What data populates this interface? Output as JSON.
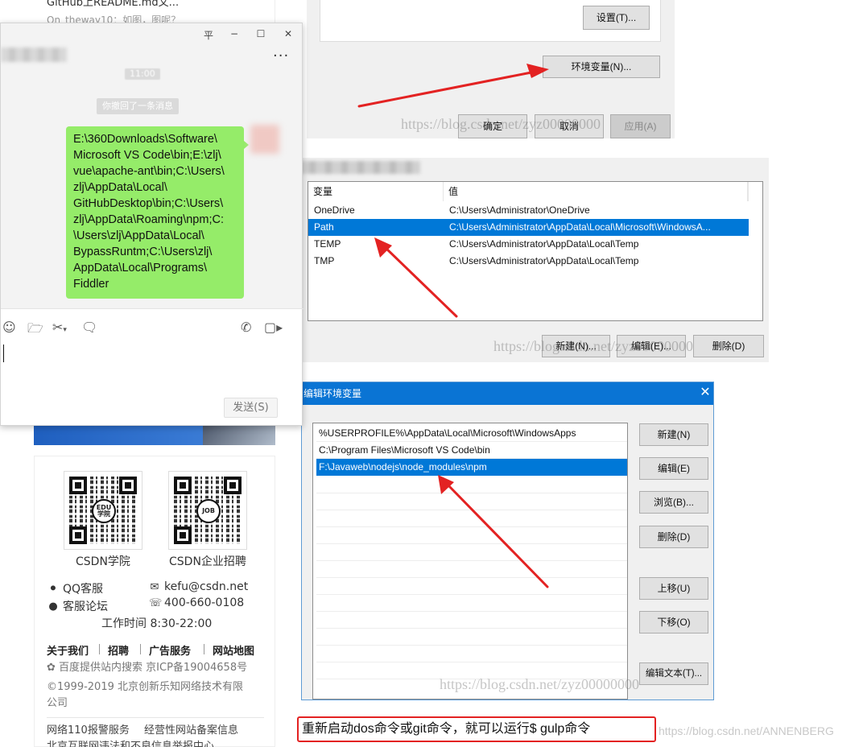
{
  "csdn": {
    "top_text": "GitHub上README.md文...",
    "top_meta": "On_theway10：如图，图呢？",
    "qr": [
      {
        "caption": "CSDN学院",
        "logo": "EDU 学院"
      },
      {
        "caption": "CSDN企业招聘",
        "logo": "JOB"
      }
    ],
    "contact": {
      "qq": "QQ客服",
      "email": "kefu@csdn.net",
      "forum": "客服论坛",
      "phone": "400-660-0108",
      "hours": "工作时间 8:30-22:00"
    },
    "footer_links": [
      "关于我们",
      "招聘",
      "广告服务",
      "网站地图"
    ],
    "footer_lines": [
      "百度提供站内搜索 京ICP备19004658号",
      "©1999-2019 北京创新乐知网络技术有限",
      "公司"
    ],
    "footer_bottom": [
      "网络110报警服务",
      "经营性网站备案信息"
    ],
    "footer_cut": "北京互联网违法和不良信息举报中心"
  },
  "chat": {
    "window_buttons": {
      "pin": "平",
      "minimize": "−",
      "maximize": "☐",
      "close": "✕"
    },
    "more": "···",
    "time": "11:00",
    "recall_notice": "你撤回了一条消息",
    "message": "E:\\360Downloads\\Software\\\nMicrosoft VS Code\\bin;E:\\zlj\\\nvue\\apache-ant\\bin;C:\\Users\\\nzlj\\AppData\\Local\\\nGitHubDesktop\\bin;C:\\Users\\\nzlj\\AppData\\Roaming\\npm;C:\n\\Users\\zlj\\AppData\\Local\\\nBypassRuntm;C:\\Users\\zlj\\\nAppData\\Local\\Programs\\\nFiddler",
    "send_label": "发送(S)"
  },
  "sysprops": {
    "settings_button": "设置(T)...",
    "env_button": "环境变量(N)...",
    "ok": "确定",
    "cancel": "取消",
    "apply": "应用(A)"
  },
  "env_dialog": {
    "columns": [
      "变量",
      "值"
    ],
    "rows": [
      {
        "name": "OneDrive",
        "value": "C:\\Users\\Administrator\\OneDrive",
        "selected": false
      },
      {
        "name": "Path",
        "value": "C:\\Users\\Administrator\\AppData\\Local\\Microsoft\\WindowsA...",
        "selected": true
      },
      {
        "name": "TEMP",
        "value": "C:\\Users\\Administrator\\AppData\\Local\\Temp",
        "selected": false
      },
      {
        "name": "TMP",
        "value": "C:\\Users\\Administrator\\AppData\\Local\\Temp",
        "selected": false
      }
    ],
    "buttons": {
      "new": "新建(N)...",
      "edit": "编辑(E)...",
      "delete": "删除(D)"
    }
  },
  "edit_dialog": {
    "title": "编辑环境变量",
    "close": "✕",
    "entries": [
      {
        "text": "%USERPROFILE%\\AppData\\Local\\Microsoft\\WindowsApps",
        "selected": false
      },
      {
        "text": "C:\\Program Files\\Microsoft VS Code\\bin",
        "selected": false
      },
      {
        "text": "F:\\Javaweb\\nodejs\\node_modules\\npm",
        "selected": true
      }
    ],
    "buttons": {
      "new": "新建(N)",
      "edit": "编辑(E)",
      "browse": "浏览(B)...",
      "delete": "删除(D)",
      "move_up": "上移(U)",
      "move_down": "下移(O)",
      "edit_text": "编辑文本(T)..."
    }
  },
  "watermarks": {
    "w1": "https://blog.csdn.net/zyz00000000",
    "w2": "https://blog.csdn.net/zyz00000000",
    "w3": "https://blog.csdn.net/zyz00000000",
    "bottom": "https://blog.csdn.net/ANNENBERG"
  },
  "caption": "重新启动dos命令或git命令，就可以运行$ gulp命令",
  "colors": {
    "selection": "#0078d7",
    "titlebar": "#0a74d4",
    "chat_bubble": "#95ec69",
    "arrow": "#e32222",
    "caption_border": "#e32222"
  }
}
